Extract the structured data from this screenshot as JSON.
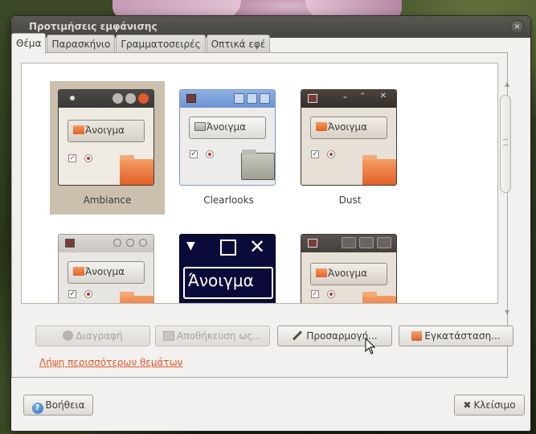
{
  "window": {
    "title": "Προτιμήσεις εμφάνισης",
    "close_glyph": "×"
  },
  "tabs": [
    {
      "label": "Θέμα",
      "active": true
    },
    {
      "label": "Παρασκήνιο",
      "active": false
    },
    {
      "label": "Γραμματοσειρές",
      "active": false
    },
    {
      "label": "Οπτικά εφέ",
      "active": false
    }
  ],
  "themes": [
    {
      "name": "Ambiance",
      "preview_button": "Άνοιγμα",
      "selected": true,
      "style": "ambiance"
    },
    {
      "name": "Clearlooks",
      "preview_button": "Άνοιγμα",
      "selected": false,
      "style": "clearlooks"
    },
    {
      "name": "Dust",
      "preview_button": "Άνοιγμα",
      "selected": false,
      "style": "dust"
    },
    {
      "name": "",
      "preview_button": "Άνοιγμα",
      "selected": false,
      "style": "grey"
    },
    {
      "name": "",
      "preview_button": "Άνοιγμα",
      "selected": false,
      "style": "contrast"
    },
    {
      "name": "",
      "preview_button": "Άνοιγμα",
      "selected": false,
      "style": "dust2"
    }
  ],
  "actions": {
    "delete": "Διαγραφή",
    "save_as": "Αποθήκευση ως...",
    "customize": "Προσαρμογή...",
    "install": "Εγκατάσταση..."
  },
  "more_themes_link": "Λήψη περισσότερων θεμάτων",
  "footer": {
    "help": "Βοήθεια",
    "close": "Κλείσιμο"
  },
  "colors": {
    "selection": "#cbbfae",
    "link": "#e2582b",
    "titlebar": "#45443f"
  }
}
